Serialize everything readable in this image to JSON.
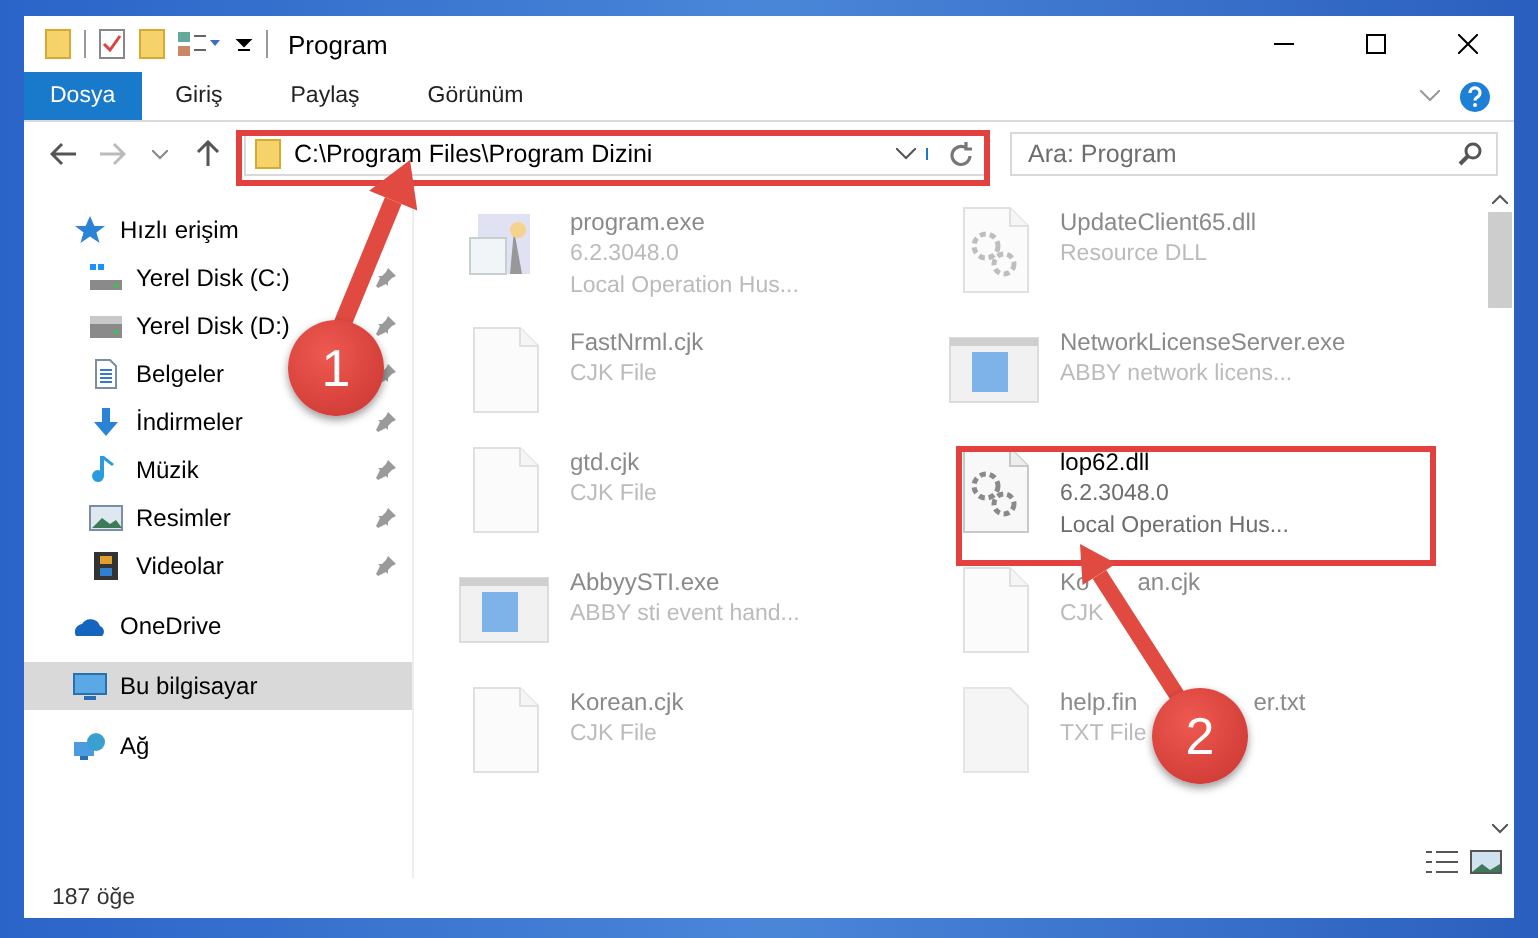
{
  "window": {
    "title": "Program"
  },
  "ribbon_tabs": [
    {
      "label": "Dosya",
      "selected": true
    },
    {
      "label": "Giriş",
      "selected": false
    },
    {
      "label": "Paylaş",
      "selected": false
    },
    {
      "label": "Görünüm",
      "selected": false
    }
  ],
  "address": {
    "path": "C:\\Program Files\\Program Dizini"
  },
  "search": {
    "placeholder": "Ara: Program"
  },
  "sidebar": {
    "items": [
      {
        "label": "Hızlı erişim",
        "kind": "star",
        "selected": false,
        "children": [
          {
            "label": "Yerel Disk (C:)",
            "kind": "drive-win",
            "pinned": true,
            "selected": false
          },
          {
            "label": "Yerel Disk (D:)",
            "kind": "drive",
            "pinned": true,
            "selected": false
          },
          {
            "label": "Belgeler",
            "kind": "document",
            "pinned": true,
            "selected": false
          },
          {
            "label": "İndirmeler",
            "kind": "download",
            "pinned": true,
            "selected": false
          },
          {
            "label": "Müzik",
            "kind": "music",
            "pinned": true,
            "selected": false
          },
          {
            "label": "Resimler",
            "kind": "image",
            "pinned": true,
            "selected": false
          },
          {
            "label": "Videolar",
            "kind": "film",
            "pinned": true,
            "selected": false
          }
        ]
      },
      {
        "label": "OneDrive",
        "kind": "cloud",
        "selected": false
      },
      {
        "label": "Bu bilgisayar",
        "kind": "computer",
        "selected": true
      },
      {
        "label": "Ağ",
        "kind": "network",
        "selected": false
      }
    ]
  },
  "files": [
    {
      "name": "program.exe",
      "lines": [
        "6.2.3048.0",
        "Local Operation Hus..."
      ],
      "kind": "setup",
      "dimmed": true
    },
    {
      "name": "UpdateClient65.dll",
      "lines": [
        "Resource DLL"
      ],
      "kind": "dll",
      "dimmed": true
    },
    {
      "name": "FastNrml.cjk",
      "lines": [
        "CJK File"
      ],
      "kind": "blank",
      "dimmed": true
    },
    {
      "name": "NetworkLicenseServer.exe",
      "lines": [
        "ABBY network licens..."
      ],
      "kind": "app",
      "dimmed": true
    },
    {
      "name": "gtd.cjk",
      "lines": [
        "CJK File"
      ],
      "kind": "blank",
      "dimmed": true
    },
    {
      "name": "lop62.dll",
      "lines": [
        "6.2.3048.0",
        "Local Operation Hus..."
      ],
      "kind": "dll",
      "dimmed": false
    },
    {
      "name": "AbbyySTI.exe",
      "lines": [
        "ABBY sti event hand..."
      ],
      "kind": "app",
      "dimmed": true
    },
    {
      "name": "Ko",
      "name_tail": "an.cjk",
      "lines": [
        "CJK"
      ],
      "kind": "blank",
      "dimmed": true
    },
    {
      "name": "Korean.cjk",
      "lines": [
        "CJK File"
      ],
      "kind": "blank",
      "dimmed": true
    },
    {
      "name": "help.fin",
      "name_tail": "er.txt",
      "lines": [
        "TXT File"
      ],
      "kind": "text",
      "dimmed": true
    }
  ],
  "status_bar": {
    "count": "187 öğe"
  },
  "annotations": [
    {
      "number": "1"
    },
    {
      "number": "2"
    }
  ]
}
